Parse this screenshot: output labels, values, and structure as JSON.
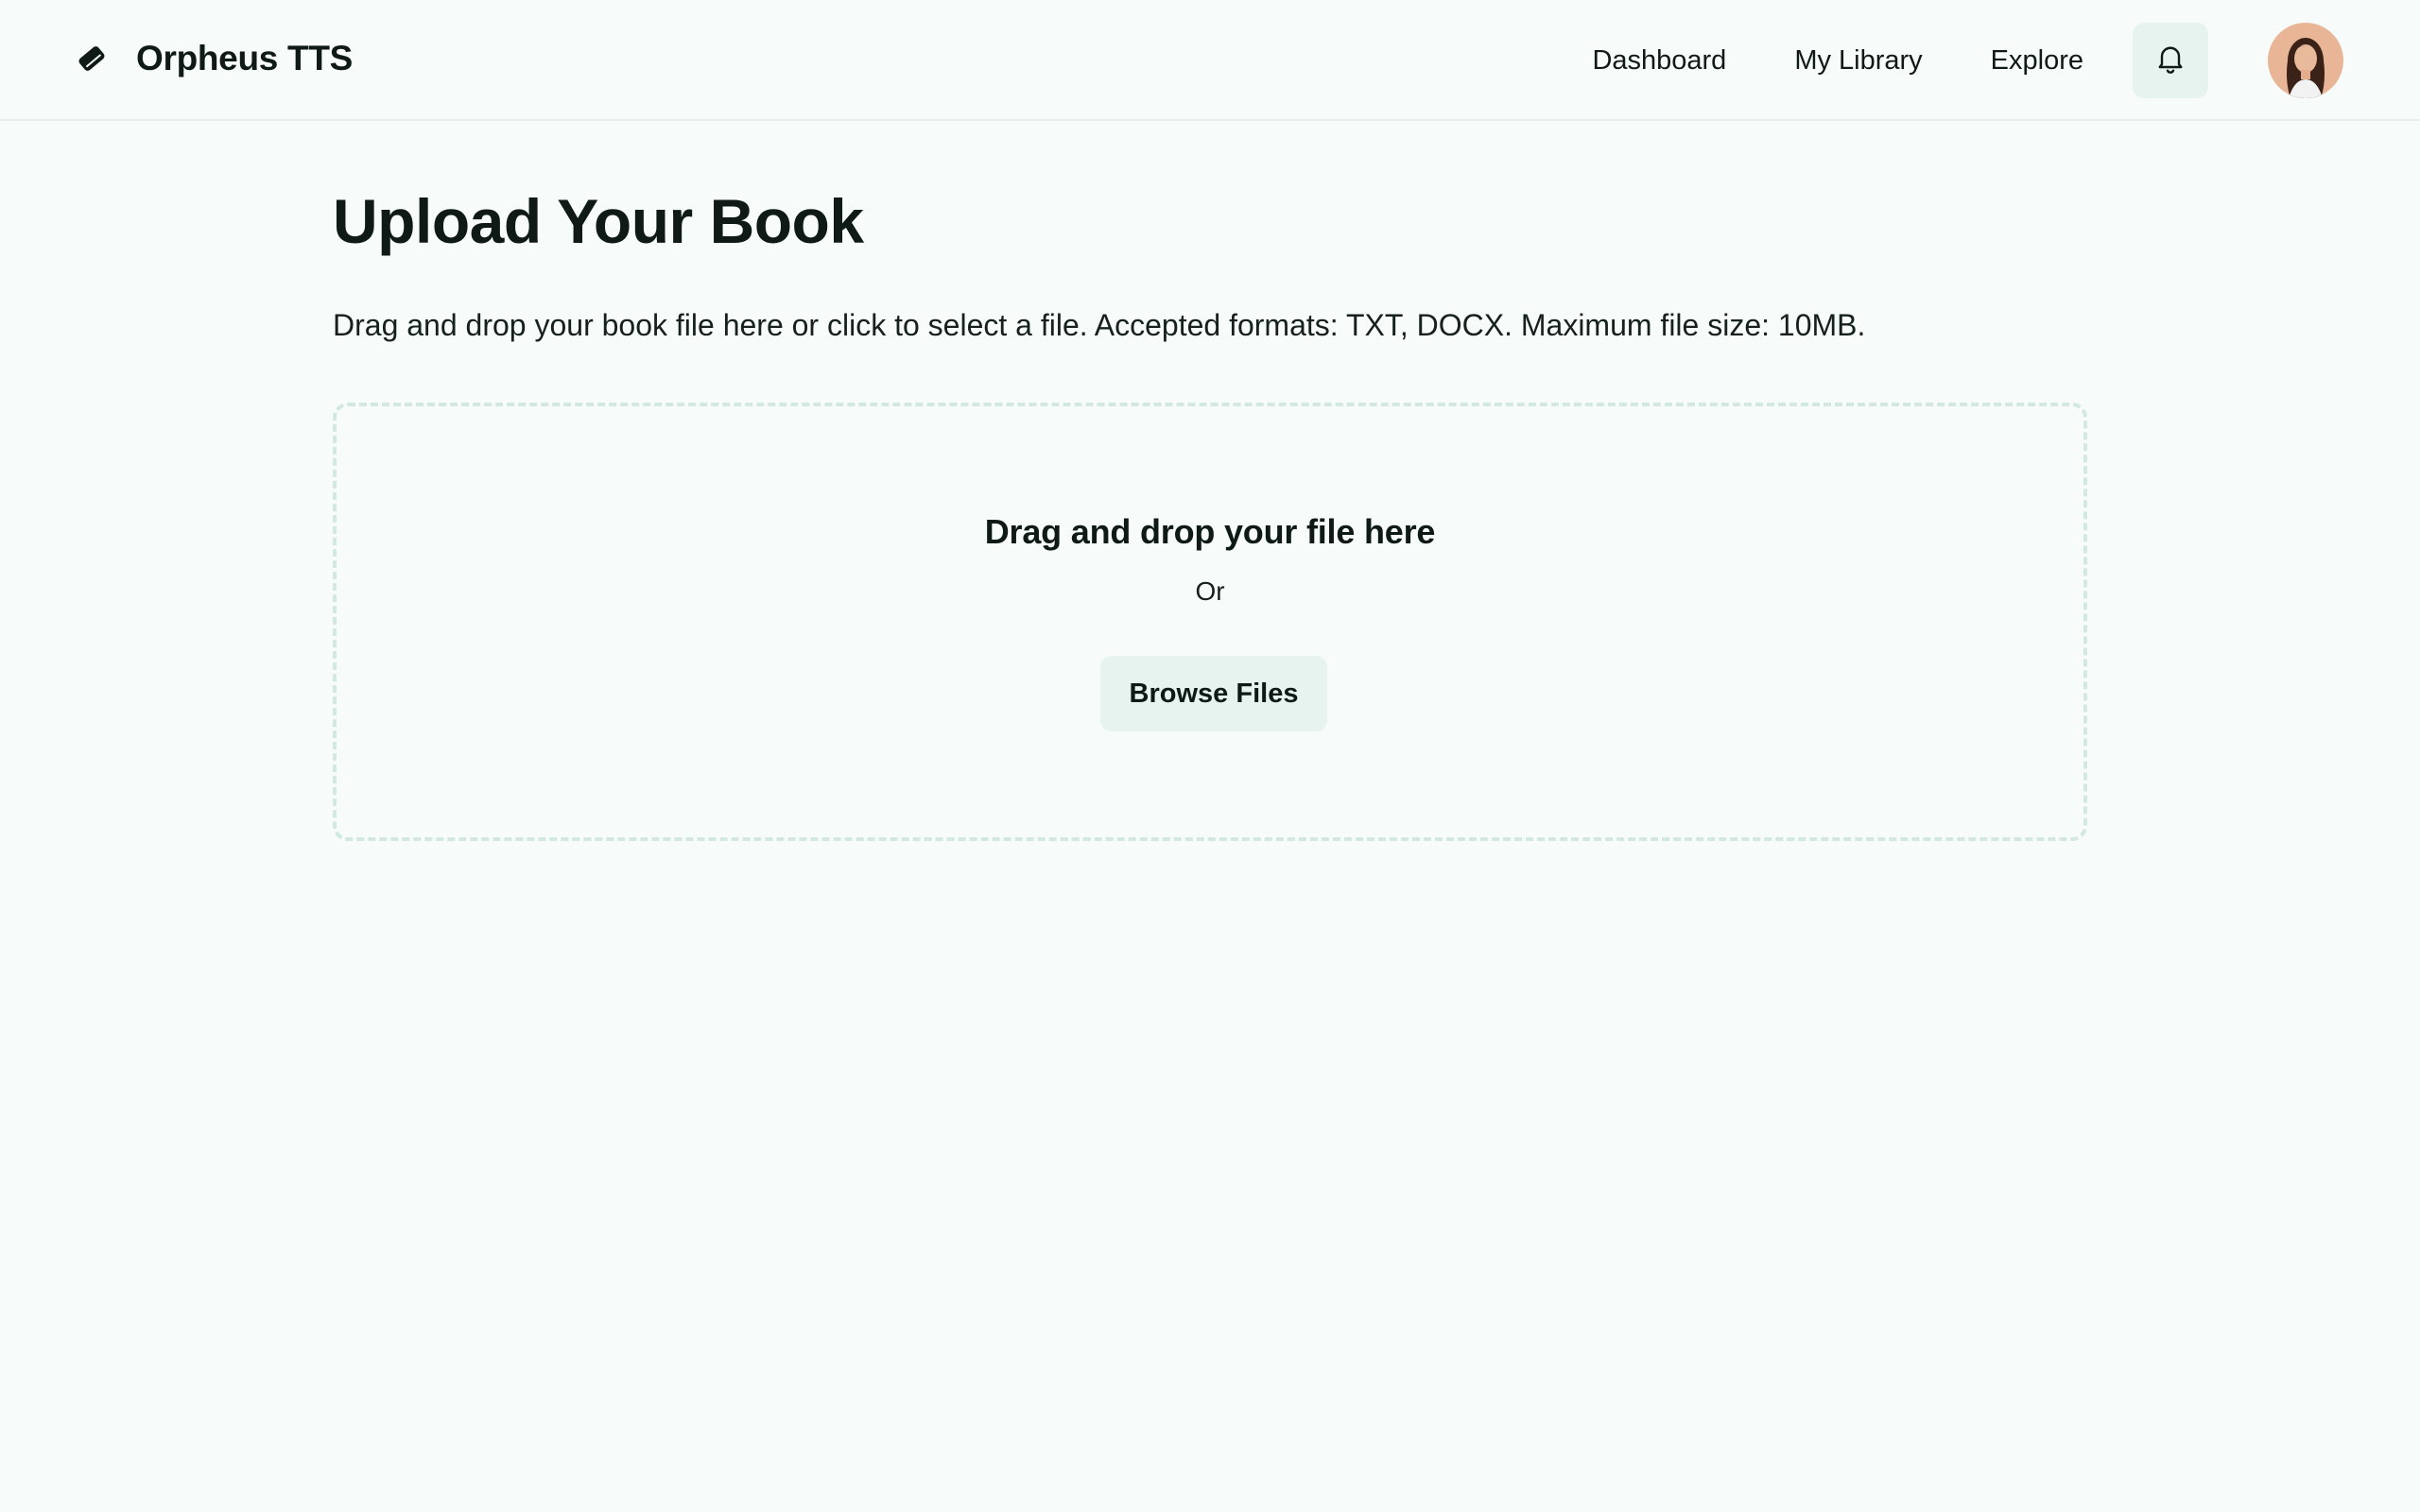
{
  "header": {
    "brand_name": "Orpheus TTS",
    "logo_icon": "book-icon",
    "nav": [
      {
        "label": "Dashboard"
      },
      {
        "label": "My Library"
      },
      {
        "label": "Explore"
      }
    ],
    "notification_icon": "bell-icon",
    "avatar_icon": "user-avatar"
  },
  "main": {
    "title": "Upload Your Book",
    "description": "Drag and drop your book file here or click to select a file. Accepted formats: TXT, DOCX. Maximum file size: 10MB.",
    "dropzone": {
      "title": "Drag and drop your file here",
      "or_text": "Or",
      "browse_label": "Browse Files"
    }
  },
  "colors": {
    "background": "#f7fbfa",
    "accent_light": "#e6f3ef",
    "dropzone_border": "#d3e8e1",
    "text_primary": "#0f1a17"
  }
}
